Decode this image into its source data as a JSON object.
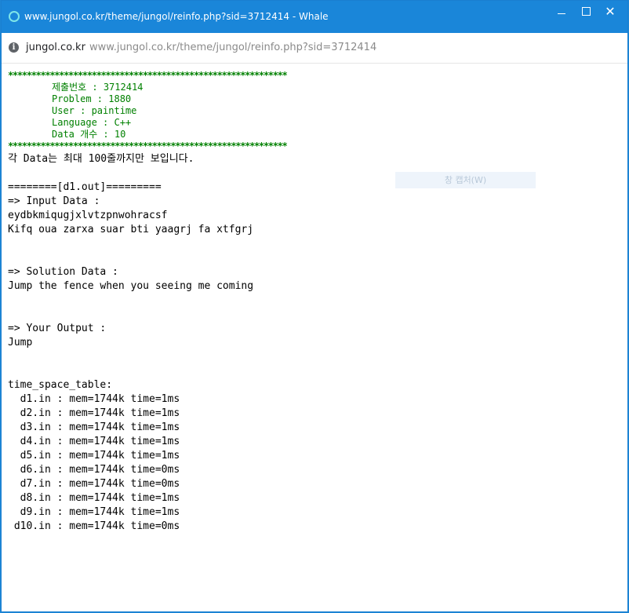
{
  "window": {
    "title": "www.jungol.co.kr/theme/jungol/reinfo.php?sid=3712414 - Whale",
    "minimize": "minimize",
    "maximize": "maximize",
    "close": "✕"
  },
  "address": {
    "domain": "jungol.co.kr",
    "url": "www.jungol.co.kr/theme/jungol/reinfo.php?sid=3712414"
  },
  "header": {
    "stars": "************************************************************",
    "submission": "제출번호 : 3712414",
    "problem": "Problem : 1880",
    "user": "User : paintime",
    "language": "Language : C++",
    "data_count": "Data 개수 : 10",
    "stars2": "************************************************************"
  },
  "notice": "각 Data는 최대 100줄까지만 보입니다.",
  "section_title": "========[d1.out]=========",
  "input": {
    "label": "=> Input Data :",
    "lines": [
      "eydbkmiqugjxlvtzpnwohracsf",
      "Kifq oua zarxa suar bti yaagrj fa xtfgrj"
    ]
  },
  "solution": {
    "label": "=> Solution Data :",
    "lines": [
      "Jump the fence when you seeing me coming"
    ]
  },
  "output": {
    "label": "=> Your Output :",
    "lines": [
      "Jump"
    ]
  },
  "time_space": {
    "label": "time_space_table:",
    "rows": [
      "  d1.in : mem=1744k time=1ms",
      "  d2.in : mem=1744k time=1ms",
      "  d3.in : mem=1744k time=1ms",
      "  d4.in : mem=1744k time=1ms",
      "  d5.in : mem=1744k time=1ms",
      "  d6.in : mem=1744k time=0ms",
      "  d7.in : mem=1744k time=0ms",
      "  d8.in : mem=1744k time=1ms",
      "  d9.in : mem=1744k time=1ms",
      " d10.in : mem=1744k time=0ms"
    ]
  },
  "ghost_button": "창 캡처(W)"
}
